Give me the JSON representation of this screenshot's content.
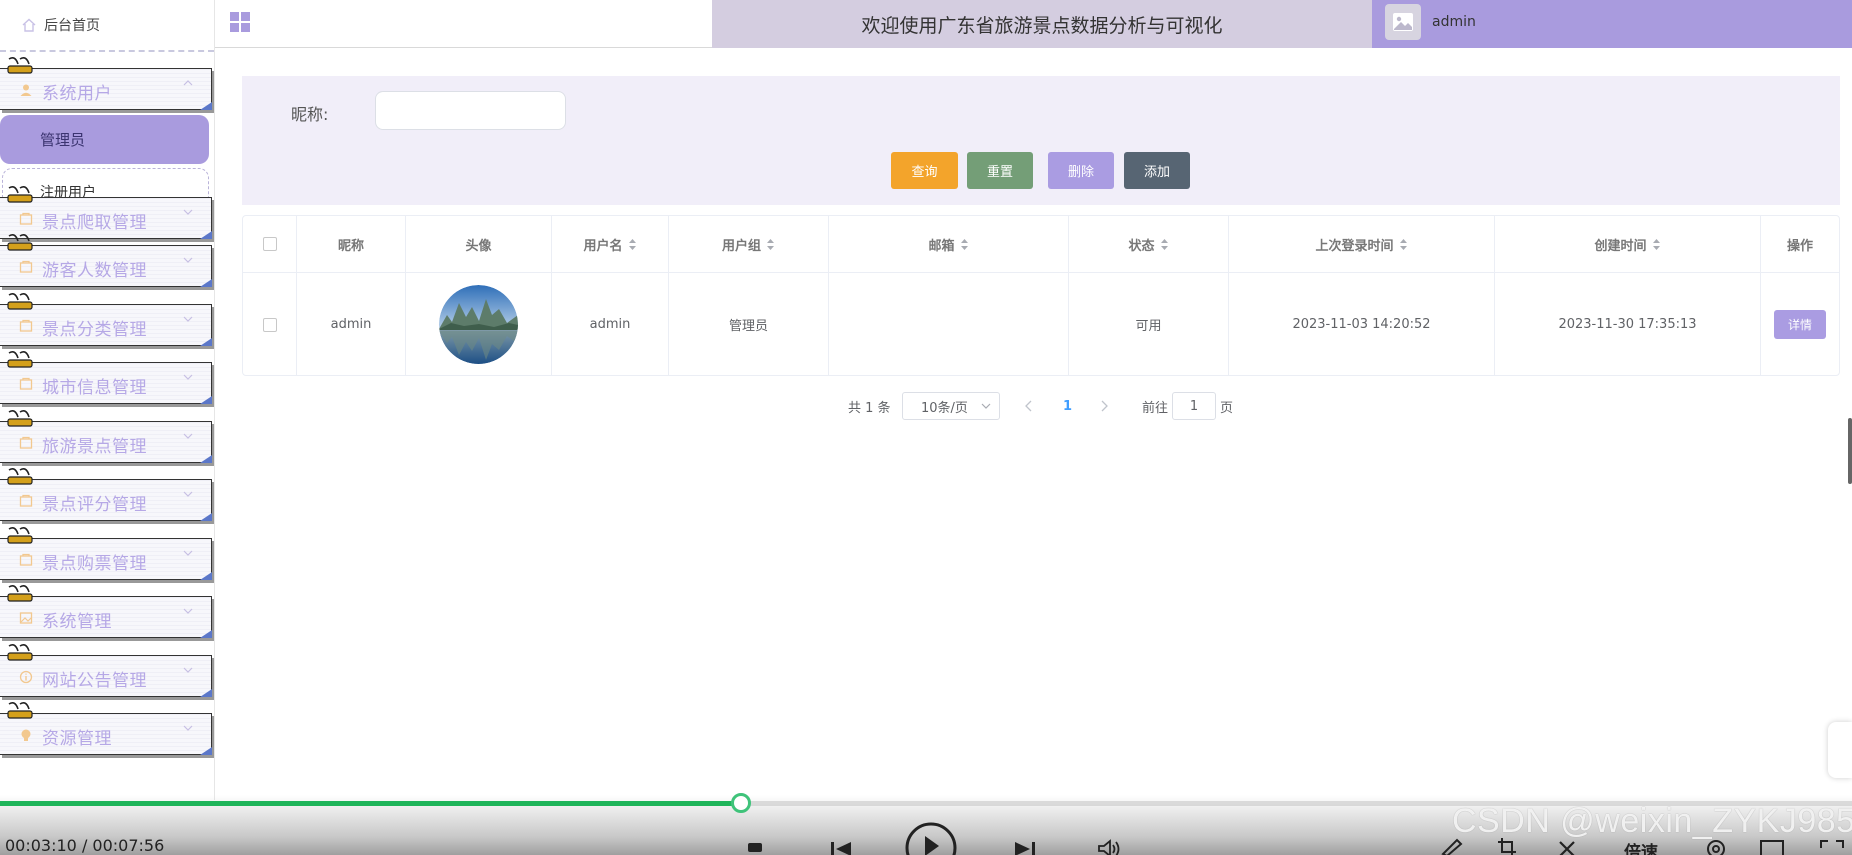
{
  "sidebar": {
    "home_label": "后台首页",
    "items": [
      {
        "label": "系统用户"
      },
      {
        "label": "景点爬取管理"
      },
      {
        "label": "游客人数管理"
      },
      {
        "label": "景点分类管理"
      },
      {
        "label": "城市信息管理"
      },
      {
        "label": "旅游景点管理"
      },
      {
        "label": "景点评分管理"
      },
      {
        "label": "景点购票管理"
      },
      {
        "label": "系统管理"
      },
      {
        "label": "网站公告管理"
      },
      {
        "label": "资源管理"
      }
    ],
    "sub_items": [
      {
        "label": "管理员",
        "active": true
      },
      {
        "label": "注册用户",
        "active": false
      }
    ]
  },
  "header": {
    "title": "欢迎使用广东省旅游景点数据分析与可视化",
    "user": "admin"
  },
  "search": {
    "nickname_label": "昵称:",
    "nickname_value": "",
    "buttons": {
      "query": "查询",
      "reset": "重置",
      "delete": "删除",
      "add": "添加"
    }
  },
  "table": {
    "columns": [
      "昵称",
      "头像",
      "用户名",
      "用户组",
      "邮箱",
      "状态",
      "上次登录时间",
      "创建时间",
      "操作"
    ],
    "rows": [
      {
        "nickname": "admin",
        "username": "admin",
        "group": "管理员",
        "email": "",
        "status": "可用",
        "last_login": "2023-11-03 14:20:52",
        "created": "2023-11-30 17:35:13",
        "action": "详情"
      }
    ]
  },
  "pagination": {
    "total": "共 1 条",
    "page_size": "10条/页",
    "current_page": "1",
    "goto_label": "前往",
    "goto_value": "1",
    "page_suffix": "页"
  },
  "player": {
    "time": "00:03:10 / 00:07:56",
    "progress": 0.4,
    "speed_label": "倍速",
    "watermark": "CSDN @weixin_ZYKJ985"
  },
  "colors": {
    "accent": "#a99bde",
    "header_title_bg": "#d4cde0",
    "search_bg": "#f1eef9",
    "query": "#f3a42b",
    "reset": "#749e77",
    "delete": "#aa9ce2",
    "add": "#576573",
    "progress": "#1fb55a"
  }
}
